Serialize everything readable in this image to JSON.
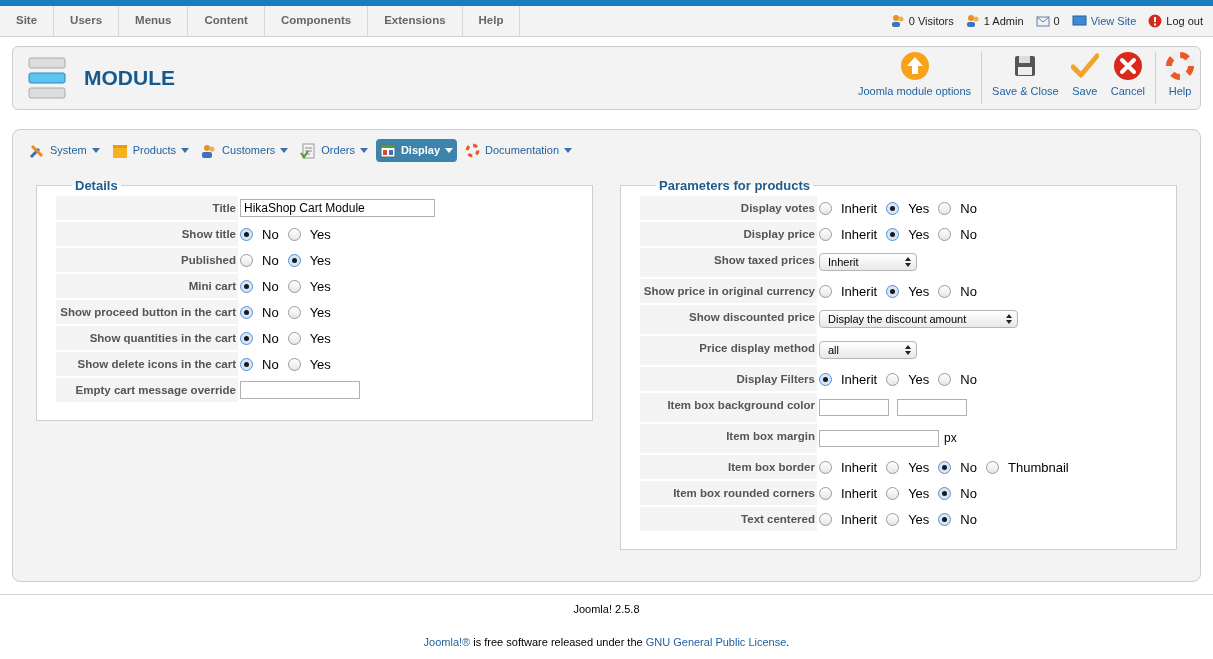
{
  "top_menu": [
    {
      "label": "Site"
    },
    {
      "label": "Users"
    },
    {
      "label": "Menus"
    },
    {
      "label": "Content"
    },
    {
      "label": "Components"
    },
    {
      "label": "Extensions"
    },
    {
      "label": "Help"
    }
  ],
  "status": [
    {
      "kind": "visitors",
      "label": "0 Visitors"
    },
    {
      "kind": "admin",
      "label": "1 Admin"
    },
    {
      "kind": "messages",
      "label": "0"
    },
    {
      "kind": "site",
      "label": "View Site"
    },
    {
      "kind": "logout",
      "label": "Log out"
    }
  ],
  "page_title": "MODULE",
  "toolbar": [
    {
      "kind": "options",
      "label": "Joomla module options"
    },
    {
      "kind": "save-close",
      "label": "Save & Close"
    },
    {
      "kind": "save",
      "label": "Save"
    },
    {
      "kind": "cancel",
      "label": "Cancel"
    },
    {
      "kind": "help",
      "label": "Help"
    }
  ],
  "tabs": [
    {
      "kind": "system",
      "label": "System",
      "selected": false
    },
    {
      "kind": "products",
      "label": "Products",
      "selected": false
    },
    {
      "kind": "customers",
      "label": "Customers",
      "selected": false
    },
    {
      "kind": "orders",
      "label": "Orders",
      "selected": false
    },
    {
      "kind": "display",
      "label": "Display",
      "selected": true
    },
    {
      "kind": "documentation",
      "label": "Documentation",
      "selected": false
    }
  ],
  "details": {
    "legend": "Details",
    "rows": [
      {
        "kind": "text",
        "label": "Title",
        "value": "HikaShop Cart Module"
      },
      {
        "kind": "radio",
        "label": "Show title",
        "options": [
          {
            "label": "No",
            "selected": true
          },
          {
            "label": "Yes",
            "selected": false
          }
        ]
      },
      {
        "kind": "radio",
        "label": "Published",
        "options": [
          {
            "label": "No",
            "selected": false
          },
          {
            "label": "Yes",
            "selected": true
          }
        ]
      },
      {
        "kind": "radio",
        "label": "Mini cart",
        "options": [
          {
            "label": "No",
            "selected": true
          },
          {
            "label": "Yes",
            "selected": false
          }
        ]
      },
      {
        "kind": "radio",
        "label": "Show proceed button in the cart",
        "options": [
          {
            "label": "No",
            "selected": true
          },
          {
            "label": "Yes",
            "selected": false
          }
        ]
      },
      {
        "kind": "radio",
        "label": "Show quantities in the cart",
        "options": [
          {
            "label": "No",
            "selected": true
          },
          {
            "label": "Yes",
            "selected": false
          }
        ]
      },
      {
        "kind": "radio",
        "label": "Show delete icons in the cart",
        "options": [
          {
            "label": "No",
            "selected": true
          },
          {
            "label": "Yes",
            "selected": false
          }
        ]
      },
      {
        "kind": "text",
        "label": "Empty cart message override"
      }
    ]
  },
  "parameters": {
    "legend": "Parameters for products",
    "rows": [
      {
        "kind": "radio",
        "label": "Display votes",
        "options": [
          {
            "label": "Inherit",
            "selected": false
          },
          {
            "label": "Yes",
            "selected": true
          },
          {
            "label": "No",
            "selected": false
          }
        ]
      },
      {
        "kind": "radio",
        "label": "Display price",
        "options": [
          {
            "label": "Inherit",
            "selected": false
          },
          {
            "label": "Yes",
            "selected": true
          },
          {
            "label": "No",
            "selected": false
          }
        ]
      },
      {
        "kind": "select",
        "label": "Show taxed prices",
        "value": "Inherit"
      },
      {
        "kind": "radio",
        "label": "Show price in original currency",
        "options": [
          {
            "label": "Inherit",
            "selected": false
          },
          {
            "label": "Yes",
            "selected": true
          },
          {
            "label": "No",
            "selected": false
          }
        ]
      },
      {
        "kind": "select",
        "label": "Show discounted price",
        "value": "Display the discount amount"
      },
      {
        "kind": "select",
        "label": "Price display method",
        "value": "all"
      },
      {
        "kind": "radio",
        "label": "Display Filters",
        "options": [
          {
            "label": "Inherit",
            "selected": true
          },
          {
            "label": "Yes",
            "selected": false
          },
          {
            "label": "No",
            "selected": false
          }
        ]
      },
      {
        "kind": "color",
        "label": "Item box background color"
      },
      {
        "kind": "margin",
        "label": "Item box margin",
        "unit": "px"
      },
      {
        "kind": "radio",
        "label": "Item box border",
        "options": [
          {
            "label": "Inherit",
            "selected": false
          },
          {
            "label": "Yes",
            "selected": false
          },
          {
            "label": "No",
            "selected": true
          },
          {
            "label": "Thumbnail",
            "selected": false
          }
        ]
      },
      {
        "kind": "radio",
        "label": "Item box rounded corners",
        "options": [
          {
            "label": "Inherit",
            "selected": false
          },
          {
            "label": "Yes",
            "selected": false
          },
          {
            "label": "No",
            "selected": true
          }
        ]
      },
      {
        "kind": "radio",
        "label": "Text centered",
        "options": [
          {
            "label": "Inherit",
            "selected": false
          },
          {
            "label": "Yes",
            "selected": false
          },
          {
            "label": "No",
            "selected": true
          }
        ]
      }
    ]
  },
  "footer": {
    "version": "Joomla! 2.5.8",
    "license": [
      {
        "kind": "link",
        "text": "Joomla!®"
      },
      {
        "kind": "text",
        "text": " is free software released under the "
      },
      {
        "kind": "link",
        "text": "GNU General Public License"
      },
      {
        "kind": "text",
        "text": "."
      }
    ]
  }
}
